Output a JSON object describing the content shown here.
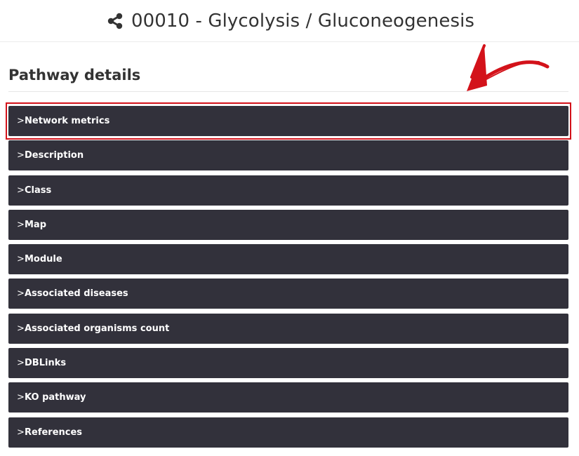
{
  "header": {
    "title": "00010 - Glycolysis / Gluconeogenesis",
    "icon": "share-icon"
  },
  "section": {
    "title": "Pathway details"
  },
  "accordion": {
    "chevron": ">",
    "items": [
      {
        "label": "Network metrics",
        "highlighted": true
      },
      {
        "label": "Description"
      },
      {
        "label": "Class"
      },
      {
        "label": "Map"
      },
      {
        "label": "Module"
      },
      {
        "label": "Associated diseases"
      },
      {
        "label": "Associated organisms count"
      },
      {
        "label": "DBLinks"
      },
      {
        "label": "KO pathway"
      },
      {
        "label": "References"
      }
    ]
  },
  "colors": {
    "accordion_bg": "#32313b",
    "highlight": "#d3121a",
    "text_dark": "#333333"
  },
  "annotation": {
    "arrow": "red-arrow-icon"
  }
}
